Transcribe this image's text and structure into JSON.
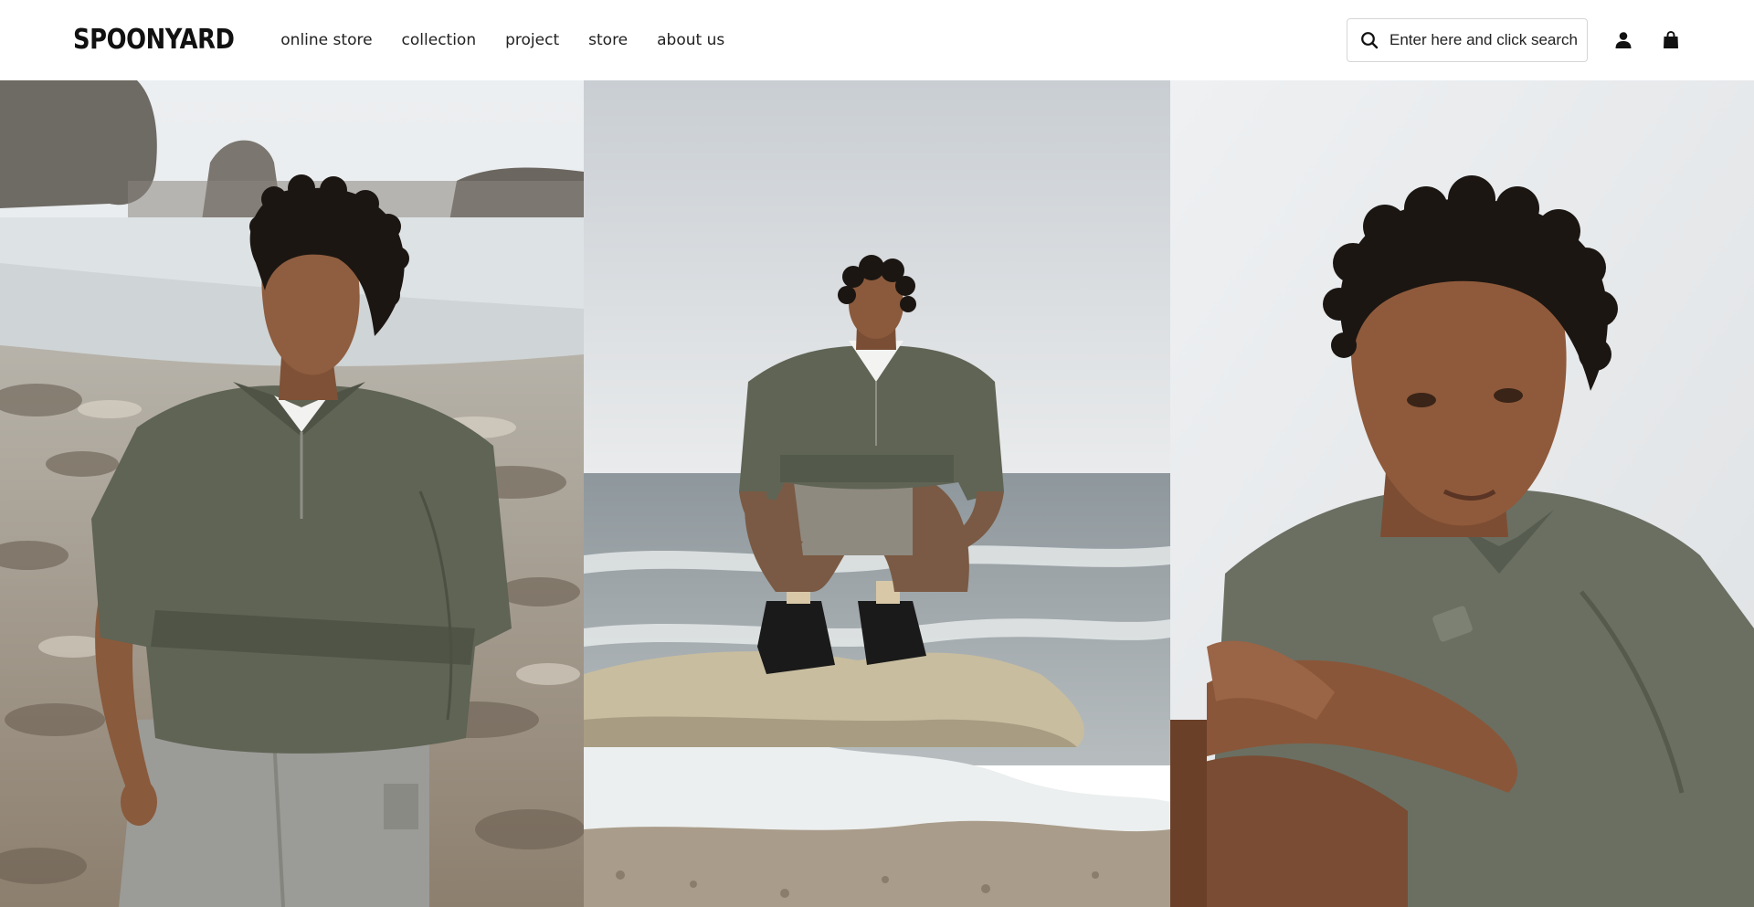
{
  "header": {
    "logo": "SPOONYARD",
    "nav": [
      {
        "label": "online store"
      },
      {
        "label": "collection"
      },
      {
        "label": "project"
      },
      {
        "label": "store"
      },
      {
        "label": "about us"
      }
    ],
    "search": {
      "placeholder": "Enter here and click search",
      "icon": "search-icon"
    },
    "account_icon": "user-icon",
    "cart_icon": "shopping-bag-icon"
  },
  "hero": {
    "images": [
      {
        "name": "model-on-rocky-beach"
      },
      {
        "name": "model-crouching-on-rock-in-sea"
      },
      {
        "name": "model-portrait-closeup"
      }
    ]
  },
  "colors": {
    "header_bg": "#ffffff",
    "text": "#222222",
    "olive_shirt": "#5f6455",
    "grey_pants": "#9a9a96",
    "sky": "#e6e8ea",
    "sea": "#9fa6aa",
    "sand": "#c9bfa8"
  }
}
